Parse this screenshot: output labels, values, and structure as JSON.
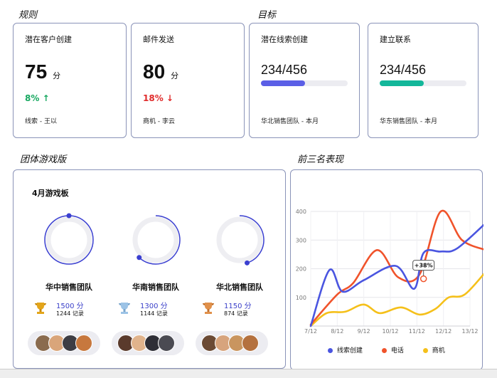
{
  "sections": {
    "rules": "规则",
    "goals": "目标",
    "team_board": "团体游戏版",
    "top3": "前三名表现"
  },
  "cards": [
    {
      "label": "潜在客户创建",
      "value": "75",
      "unit": "分",
      "pct": "8%",
      "pct_dir": "up",
      "pct_color": "#17a860",
      "foot": "线索 - 王以"
    },
    {
      "label": "邮件发送",
      "value": "80",
      "unit": "分",
      "pct": "18%",
      "pct_dir": "down",
      "pct_color": "#e02b2b",
      "foot": "商机 - 李云"
    }
  ],
  "goals": [
    {
      "label": "潜在线索创建",
      "ratio": "234/456",
      "progress": 0.51,
      "color": "#5b5fe6",
      "foot": "华北销售团队 - 本月"
    },
    {
      "label": "建立联系",
      "ratio": "234/456",
      "progress": 0.51,
      "color": "#13b79a",
      "foot": "华东销售团队 - 本月"
    }
  ],
  "board": {
    "title": "4月游戏板",
    "teams": [
      {
        "name": "华中销售团队",
        "score": "1500 分",
        "records": "1244 记录",
        "ring_progress": 1.0,
        "trophy": "gold-trophy-icon",
        "trophy_color": "#e3a51a"
      },
      {
        "name": "华南销售团队",
        "score": "1300 分",
        "records": "1144 记录",
        "ring_progress": 0.62,
        "trophy": "silver-trophy-icon",
        "trophy_color": "#9cc3e6"
      },
      {
        "name": "华北销售团队",
        "score": "1150 分",
        "records": "874 记录",
        "ring_progress": 0.45,
        "trophy": "bronze-trophy-icon",
        "trophy_color": "#e0904a"
      }
    ]
  },
  "chart_data": {
    "type": "line",
    "x": [
      "7/12",
      "8/12",
      "9/12",
      "10/12",
      "11/12",
      "12/12",
      "13/12"
    ],
    "ylim": [
      0,
      400
    ],
    "yticks": [
      100,
      200,
      300,
      400
    ],
    "annotation": "+38%",
    "series": [
      {
        "name": "线索创建",
        "color": "#4a55e0",
        "points": [
          [
            0,
            0
          ],
          [
            0.7,
            195
          ],
          [
            1.2,
            120
          ],
          [
            2,
            160
          ],
          [
            3.2,
            210
          ],
          [
            3.9,
            130
          ],
          [
            4.25,
            255
          ],
          [
            4.9,
            260
          ],
          [
            5.5,
            270
          ],
          [
            6.6,
            360
          ]
        ]
      },
      {
        "name": "电话",
        "color": "#f0532b",
        "points": [
          [
            0,
            5
          ],
          [
            1,
            110
          ],
          [
            1.6,
            150
          ],
          [
            2.5,
            265
          ],
          [
            3.3,
            170
          ],
          [
            4.1,
            180
          ],
          [
            4.9,
            400
          ],
          [
            5.7,
            300
          ],
          [
            6.6,
            265
          ]
        ]
      },
      {
        "name": "商机",
        "color": "#f5c01a",
        "points": [
          [
            0,
            0
          ],
          [
            0.6,
            45
          ],
          [
            1.3,
            50
          ],
          [
            2,
            75
          ],
          [
            2.6,
            45
          ],
          [
            3.4,
            65
          ],
          [
            4.1,
            40
          ],
          [
            4.7,
            60
          ],
          [
            5.2,
            100
          ],
          [
            5.8,
            110
          ],
          [
            6.6,
            190
          ]
        ]
      }
    ]
  }
}
